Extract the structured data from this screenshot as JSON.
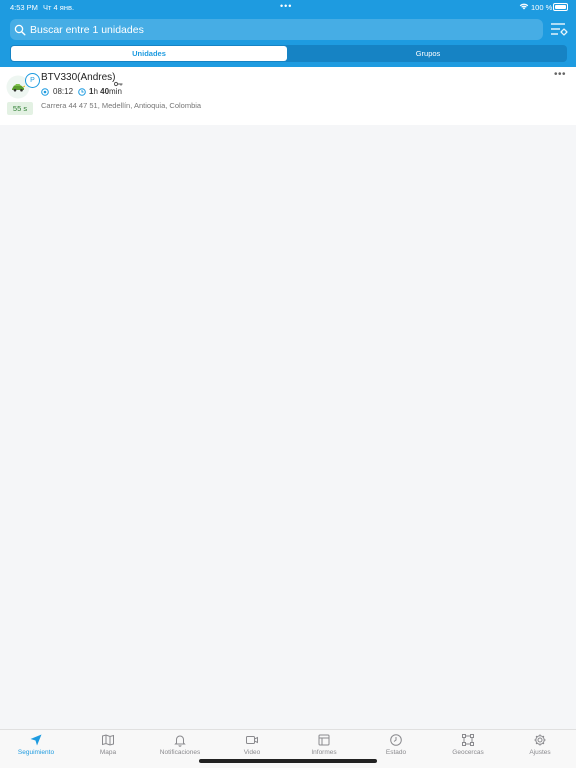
{
  "status_bar": {
    "time": "4:53 PM",
    "date": "Чт 4 янв.",
    "dots": "•••",
    "battery": "100 %"
  },
  "search": {
    "placeholder": "Buscar entre 1 unidades"
  },
  "segments": {
    "units": "Unidades",
    "groups": "Grupos"
  },
  "unit": {
    "name": "BTV330(Andres)",
    "status_badge": "P",
    "last_update": "55 s",
    "time": "08:12",
    "duration_h": "1",
    "duration_h_unit": "h",
    "duration_m": "40",
    "duration_m_unit": "min",
    "address": "Carrera 44 47 51, Medellín, Antioquia, Colombia",
    "menu": "•••"
  },
  "tabs": [
    {
      "label": "Seguimiento",
      "icon": "navigation-arrow-icon"
    },
    {
      "label": "Mapa",
      "icon": "map-icon"
    },
    {
      "label": "Notificaciones",
      "icon": "bell-icon"
    },
    {
      "label": "Video",
      "icon": "video-icon"
    },
    {
      "label": "Informes",
      "icon": "report-icon"
    },
    {
      "label": "Estado",
      "icon": "clock-icon"
    },
    {
      "label": "Geocercas",
      "icon": "geofence-icon"
    },
    {
      "label": "Ajustes",
      "icon": "gear-icon"
    }
  ],
  "colors": {
    "accent": "#1e9be0",
    "segment_bg": "#1683c4",
    "last_update_bg": "#e3f1e3"
  }
}
